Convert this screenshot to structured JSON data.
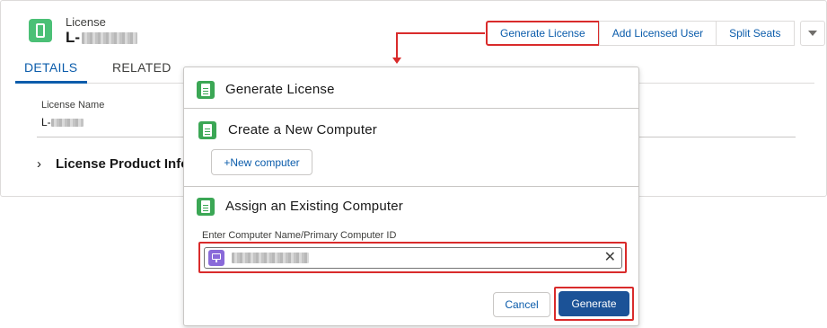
{
  "record": {
    "type_label": "License",
    "title_prefix": "L-",
    "icon": "phone-icon"
  },
  "actions": {
    "generate_license": "Generate License",
    "add_licensed_user": "Add Licensed User",
    "split_seats": "Split Seats",
    "more_icon": "chevron-down-icon"
  },
  "tabs": {
    "details": "DETAILS",
    "related": "RELATED"
  },
  "details": {
    "license_name_label": "License Name",
    "license_name_prefix": "L-",
    "section_title": "License Product Info",
    "section_toggle": "›"
  },
  "modal": {
    "title": "Generate License",
    "create_section_title": "Create a New Computer",
    "new_computer_button": "+New computer",
    "assign_section_title": "Assign an Existing Computer",
    "input_label": "Enter Computer Name/Primary Computer ID",
    "clear_symbol": "✕",
    "cancel_button": "Cancel",
    "generate_button": "Generate"
  },
  "colors": {
    "brand_blue": "#0b5cab",
    "primary_button": "#1b5297",
    "highlight_red": "#d92b2b",
    "record_icon_green": "#4bc076",
    "doc_icon_green": "#3ba755",
    "computer_icon_purple": "#8a6ad9"
  }
}
